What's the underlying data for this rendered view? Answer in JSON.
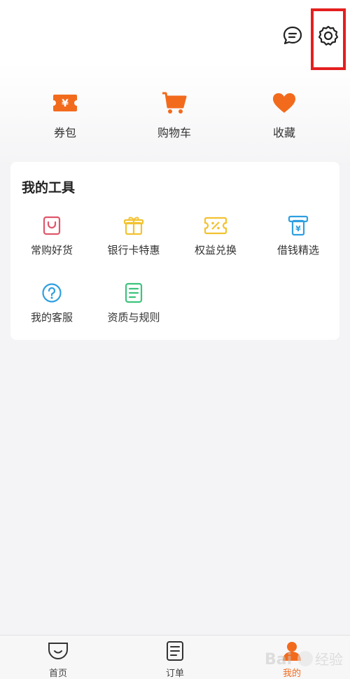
{
  "top_bar": {
    "icons": [
      "message-icon",
      "settings-icon"
    ]
  },
  "quick_actions": [
    {
      "label": "券包",
      "icon": "coupon-icon"
    },
    {
      "label": "购物车",
      "icon": "cart-icon"
    },
    {
      "label": "收藏",
      "icon": "heart-icon"
    }
  ],
  "tools": {
    "title": "我的工具",
    "items": [
      {
        "label": "常购好货",
        "icon": "bag-icon",
        "color": "#e0566b"
      },
      {
        "label": "银行卡特惠",
        "icon": "gift-icon",
        "color": "#f2c230"
      },
      {
        "label": "权益兑换",
        "icon": "voucher-icon",
        "color": "#f2c230"
      },
      {
        "label": "借钱精选",
        "icon": "atm-icon",
        "color": "#2f9fe0"
      },
      {
        "label": "我的客服",
        "icon": "help-icon",
        "color": "#2f9fe0"
      },
      {
        "label": "资质与规则",
        "icon": "document-icon",
        "color": "#3cc47c"
      }
    ]
  },
  "bottom_nav": [
    {
      "label": "首页",
      "icon": "home-icon"
    },
    {
      "label": "订单",
      "icon": "order-icon"
    },
    {
      "label": "我的",
      "icon": "profile-icon",
      "active": true
    }
  ],
  "colors": {
    "accent": "#f26b1d",
    "highlight": "#e41f1f"
  }
}
